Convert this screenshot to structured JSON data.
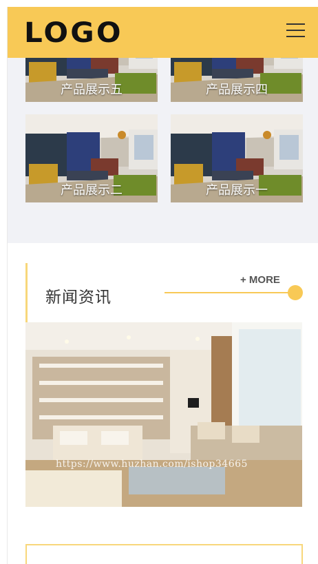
{
  "header": {
    "logo_text": "LOGO",
    "menu_icon": "hamburger-menu-icon",
    "background": "#f8c956"
  },
  "products": {
    "items": [
      {
        "caption": "产品展示五"
      },
      {
        "caption": "产品展示四"
      },
      {
        "caption": "产品展示二"
      },
      {
        "caption": "产品展示一"
      }
    ]
  },
  "news": {
    "title": "新闻资讯",
    "more_label": "+ MORE",
    "image_watermark": "https://www.huzhan.com/ishop34665"
  },
  "colors": {
    "accent": "#f8c956",
    "accent_light": "#f8d77a",
    "section_bg": "#f1f2f6"
  }
}
